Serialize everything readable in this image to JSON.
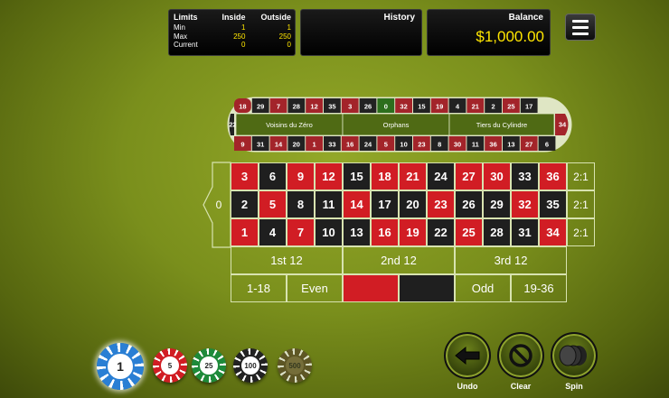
{
  "limits": {
    "title": "Limits",
    "col_inside": "Inside",
    "col_outside": "Outside",
    "rows": [
      {
        "label": "Min",
        "inside": "1",
        "outside": "1"
      },
      {
        "label": "Max",
        "inside": "250",
        "outside": "250"
      },
      {
        "label": "Current",
        "inside": "0",
        "outside": "0"
      }
    ]
  },
  "history": {
    "title": "History"
  },
  "balance": {
    "title": "Balance",
    "value": "$1,000.00"
  },
  "racetrack": {
    "top": [
      "18",
      "29",
      "7",
      "28",
      "12",
      "35",
      "3",
      "26",
      "0",
      "32",
      "15",
      "19",
      "4",
      "21",
      "2",
      "25",
      "17"
    ],
    "bottom": [
      "9",
      "31",
      "14",
      "20",
      "1",
      "33",
      "16",
      "24",
      "5",
      "10",
      "23",
      "8",
      "30",
      "11",
      "36",
      "13",
      "27",
      "6"
    ],
    "left": "22",
    "right": "34",
    "sections": [
      "Voisins du Zéro",
      "Orphans",
      "Tiers du Cylindre"
    ]
  },
  "table": {
    "zero": "0",
    "rows": [
      [
        "3",
        "6",
        "9",
        "12",
        "15",
        "18",
        "21",
        "24",
        "27",
        "30",
        "33",
        "36"
      ],
      [
        "2",
        "5",
        "8",
        "11",
        "14",
        "17",
        "20",
        "23",
        "26",
        "29",
        "32",
        "35"
      ],
      [
        "1",
        "4",
        "7",
        "10",
        "13",
        "16",
        "19",
        "22",
        "25",
        "28",
        "31",
        "34"
      ]
    ],
    "column_bets": [
      "2:1",
      "2:1",
      "2:1"
    ],
    "dozens": [
      "1st 12",
      "2nd 12",
      "3rd 12"
    ],
    "even_money": [
      "1-18",
      "Even",
      "",
      "",
      "Odd",
      "19-36"
    ]
  },
  "chips": [
    {
      "value": "1",
      "color": "#2a7fd4"
    },
    {
      "value": "5",
      "color": "#d11d24"
    },
    {
      "value": "25",
      "color": "#1e8a3a"
    },
    {
      "value": "100",
      "color": "#222222"
    },
    {
      "value": "500",
      "color": "#5a4a2a"
    }
  ],
  "controls": {
    "undo_label": "Undo",
    "clear_label": "Clear",
    "spin_label": "Spin"
  }
}
